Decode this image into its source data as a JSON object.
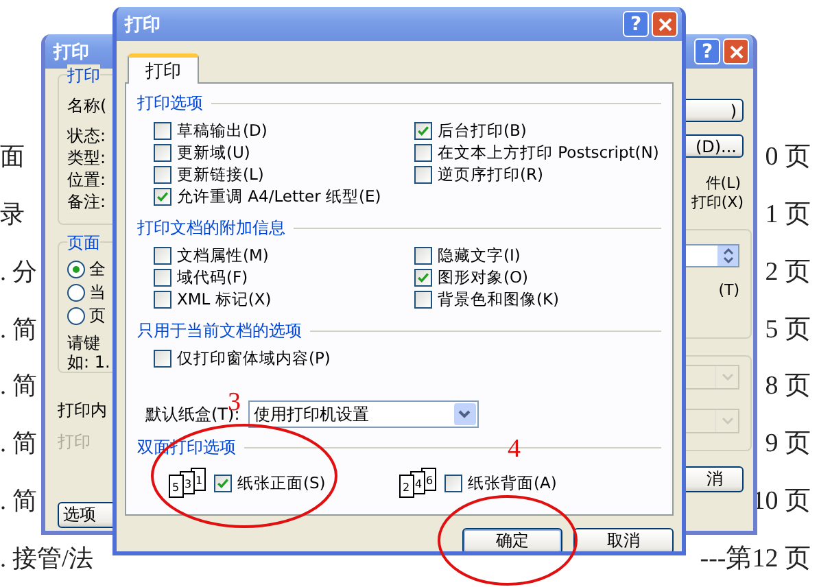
{
  "document": {
    "lines": [
      {
        "left": "面",
        "right": "0 页"
      },
      {
        "left": "录",
        "right": "1 页"
      },
      {
        "left": ". 分",
        "right": "2 页"
      },
      {
        "left": ". 简",
        "right": "5 页"
      },
      {
        "left": ". 简",
        "right": "8 页"
      },
      {
        "left": ". 简",
        "right": "9 页"
      },
      {
        "left": ". 简",
        "right": "10 页"
      },
      {
        "left": ". 接管/法",
        "right": "---第12 页"
      }
    ]
  },
  "back_dialog": {
    "title": "打印",
    "help_button": "?",
    "printer_group": "打印",
    "name_label": "名称(",
    "info_labels": [
      "状态:",
      "类型:",
      "位置:",
      "备注:"
    ],
    "range_group": "页面",
    "radios": [
      {
        "label": "全",
        "selected": true
      },
      {
        "label": "当",
        "selected": false
      },
      {
        "label": "页",
        "selected": false
      }
    ],
    "hint_lines": [
      "请键",
      "如: 1."
    ],
    "print_what": "打印内",
    "print_disabled": "打印",
    "options_button": "选项",
    "right_buttons": [
      ")",
      "(D)..."
    ],
    "right_labels": [
      "件(L)",
      "打印(X)"
    ],
    "spinner_group_label": "(T)",
    "cancel_button": "消"
  },
  "dialog": {
    "title": "打印",
    "help_button": "?",
    "tab": {
      "label": "打印",
      "selected": true
    },
    "sections": [
      {
        "title": "打印选项",
        "left": [
          {
            "label": "草稿输出(D)",
            "checked": false
          },
          {
            "label": "更新域(U)",
            "checked": false
          },
          {
            "label": "更新链接(L)",
            "checked": false
          },
          {
            "label": "允许重调 A4/Letter 纸型(E)",
            "checked": true
          }
        ],
        "right": [
          {
            "label": "后台打印(B)",
            "checked": true
          },
          {
            "label": "在文本上方打印 Postscript(N)",
            "checked": false
          },
          {
            "label": "逆页序打印(R)",
            "checked": false
          }
        ]
      },
      {
        "title": "打印文档的附加信息",
        "left": [
          {
            "label": "文档属性(M)",
            "checked": false
          },
          {
            "label": "域代码(F)",
            "checked": false
          },
          {
            "label": "XML 标记(X)",
            "checked": false
          }
        ],
        "right": [
          {
            "label": "隐藏文字(I)",
            "checked": false
          },
          {
            "label": "图形对象(O)",
            "checked": true
          },
          {
            "label": "背景色和图像(K)",
            "checked": false
          }
        ]
      },
      {
        "title": "只用于当前文档的选项",
        "left": [
          {
            "label": "仅打印窗体域内容(P)",
            "checked": false
          }
        ]
      }
    ],
    "tray": {
      "label": "默认纸盒(T):",
      "value": "使用打印机设置"
    },
    "duplex": {
      "title": "双面打印选项",
      "front": {
        "pages": [
          "5",
          "3",
          "1"
        ],
        "label": "纸张正面(S)",
        "checked": true
      },
      "back": {
        "pages": [
          "2",
          "4",
          "6"
        ],
        "label": "纸张背面(A)",
        "checked": false
      }
    },
    "buttons": [
      "确定",
      "取消"
    ]
  },
  "annotations": [
    {
      "label": "3"
    },
    {
      "label": "4"
    }
  ]
}
